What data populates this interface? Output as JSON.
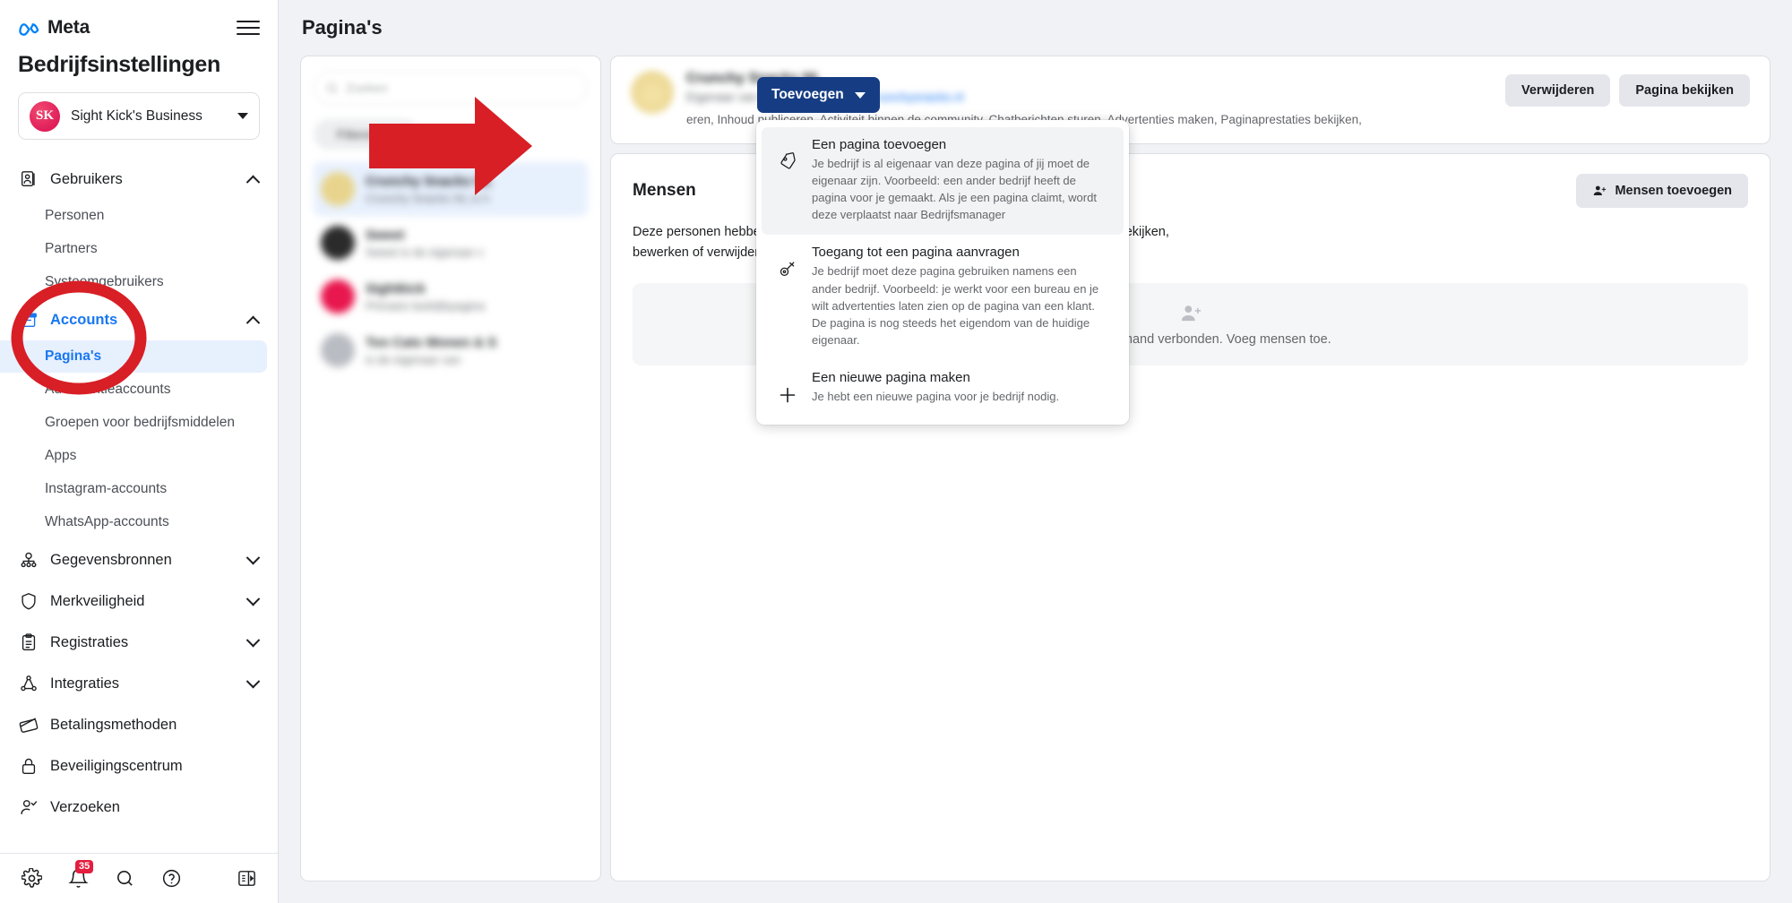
{
  "sidebar": {
    "brand": "Meta",
    "title": "Bedrijfsinstellingen",
    "business": {
      "name": "Sight Kick's Business",
      "initials": "SK"
    },
    "groups": [
      {
        "label": "Gebruikers",
        "icon": "users-icon",
        "expanded": true,
        "children": [
          {
            "label": "Personen",
            "selected": false
          },
          {
            "label": "Partners",
            "selected": false
          },
          {
            "label": "Systeemgebruikers",
            "selected": false
          }
        ]
      },
      {
        "label": "Accounts",
        "icon": "accounts-box-icon",
        "expanded": true,
        "active": true,
        "children": [
          {
            "label": "Pagina's",
            "selected": true
          },
          {
            "label": "Advertentieaccounts",
            "selected": false
          },
          {
            "label": "Groepen voor bedrijfsmiddelen",
            "selected": false
          },
          {
            "label": "Apps",
            "selected": false
          },
          {
            "label": "Instagram-accounts",
            "selected": false
          },
          {
            "label": "WhatsApp-accounts",
            "selected": false
          }
        ]
      },
      {
        "label": "Gegevensbronnen",
        "icon": "data-sources-icon",
        "expanded": false,
        "children": []
      },
      {
        "label": "Merkveiligheid",
        "icon": "shield-icon",
        "expanded": false,
        "children": []
      },
      {
        "label": "Registraties",
        "icon": "clipboard-icon",
        "expanded": false,
        "children": []
      },
      {
        "label": "Integraties",
        "icon": "integrations-icon",
        "expanded": false,
        "children": []
      },
      {
        "label": "Betalingsmethoden",
        "icon": "credit-card-icon",
        "expanded": null,
        "children": []
      },
      {
        "label": "Beveiligingscentrum",
        "icon": "lock-icon",
        "expanded": null,
        "children": []
      },
      {
        "label": "Verzoeken",
        "icon": "person-check-icon",
        "expanded": null,
        "children": []
      }
    ],
    "footer": {
      "settings_icon": "gear-icon",
      "notifications_icon": "bell-icon",
      "notifications_count": "35",
      "search_icon": "search-icon",
      "help_icon": "help-icon",
      "collapse_icon": "panel-toggle-icon"
    }
  },
  "main": {
    "page_title": "Pagina's",
    "list_panel": {
      "search_placeholder": "Zoeken",
      "filter_label": "Filteren op",
      "rows": [
        {
          "title": "Crunchy Snacks NL",
          "subtitle": "Crunchy Snacks NL is h",
          "selected": true,
          "avatar_color": "#e8d48c"
        },
        {
          "title": "Sweet",
          "subtitle": "Sweet is de eigenaar v",
          "selected": false,
          "avatar_color": "#2b2b2b"
        },
        {
          "title": "Sightkick",
          "subtitle": "Primaire bedrijfspagina",
          "selected": false,
          "avatar_color": "#e8174e"
        },
        {
          "title": "Ton Cats Wonen & S",
          "subtitle": "is de eigenaar van",
          "selected": false,
          "avatar_color": "#b9bcc2"
        }
      ]
    },
    "page_header": {
      "name": "Crunchy Snacks NL",
      "owner_line": "Eigenaar van Crunchy Snacks NL",
      "owner_link": "crunchysnacks.nl",
      "permissions": "eren, Inhoud publiceren, Activiteit binnen de community, Chatberichten sturen, Advertenties maken, Paginaprestaties bekijken,",
      "remove_label": "Verwijderen",
      "view_label": "Pagina bekijken"
    },
    "people": {
      "title": "Mensen",
      "add_label": "Mensen toevoegen",
      "add_icon": "person-add-icon",
      "description": "Deze personen hebben toegang tot Crunchy Snacks NL. Je kunt de toestemmingen bekijken, bewerken of verwijderen.",
      "empty_icon": "person-add-icon",
      "empty_text": "Er is nog niemand verbonden. Voeg mensen toe."
    },
    "add_button": {
      "label": "Toevoegen",
      "icon": "chevron-down-icon",
      "color": "#163d84"
    },
    "add_menu": {
      "items": [
        {
          "icon": "tag-icon",
          "highlighted": true,
          "title": "Een pagina toevoegen",
          "desc": "Je bedrijf is al eigenaar van deze pagina of jij moet de eigenaar zijn. Voorbeeld: een ander bedrijf heeft de pagina voor je gemaakt. Als je een pagina claimt, wordt deze verplaatst naar Bedrijfsmanager"
        },
        {
          "icon": "key-icon",
          "highlighted": false,
          "title": "Toegang tot een pagina aanvragen",
          "desc": "Je bedrijf moet deze pagina gebruiken namens een ander bedrijf. Voorbeeld: je werkt voor een bureau en je wilt advertenties laten zien op de pagina van een klant. De pagina is nog steeds het eigendom van de huidige eigenaar."
        },
        {
          "icon": "plus-icon",
          "highlighted": false,
          "title": "Een nieuwe pagina maken",
          "desc": "Je hebt een nieuwe pagina voor je bedrijf nodig."
        }
      ]
    }
  },
  "annotations": {
    "arrow_color": "#d81f26",
    "circle_color": "#d81f26",
    "arrow_name": "red-arrow-pointing-to-add-page",
    "circle_name": "red-circle-around-accounts-pages"
  }
}
